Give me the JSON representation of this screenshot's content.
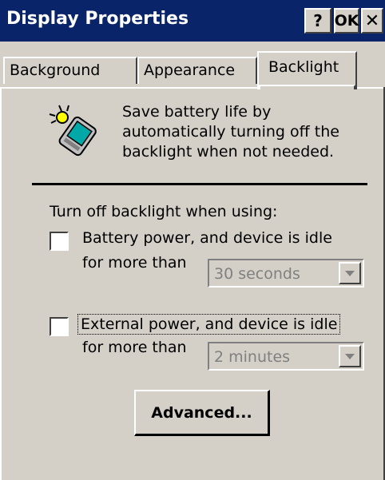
{
  "window": {
    "title": "Display Properties"
  },
  "titlebar": {
    "help_label": "?",
    "ok_label": "OK",
    "close_label": "✕"
  },
  "tabs": [
    {
      "label": "Background",
      "selected": false
    },
    {
      "label": "Appearance",
      "selected": false
    },
    {
      "label": "Backlight",
      "selected": true
    }
  ],
  "backlight": {
    "icon": "backlight-device-icon",
    "description": [
      "Save battery life by",
      "automatically turning off the",
      "backlight when not needed."
    ],
    "section_label": "Turn off backlight when using:",
    "battery": {
      "checked": false,
      "label_line1": "Battery power, and device is idle",
      "label_line2": "for more than",
      "timeout_value": "30 seconds"
    },
    "external": {
      "checked": false,
      "label_line1": "External power, and device is idle",
      "label_line2": "for more than",
      "timeout_value": "2 minutes"
    },
    "advanced_label": "Advanced..."
  },
  "colors": {
    "titlebar": "#0a246a",
    "face": "#d4d0c8",
    "disabled_text": "#808080"
  }
}
